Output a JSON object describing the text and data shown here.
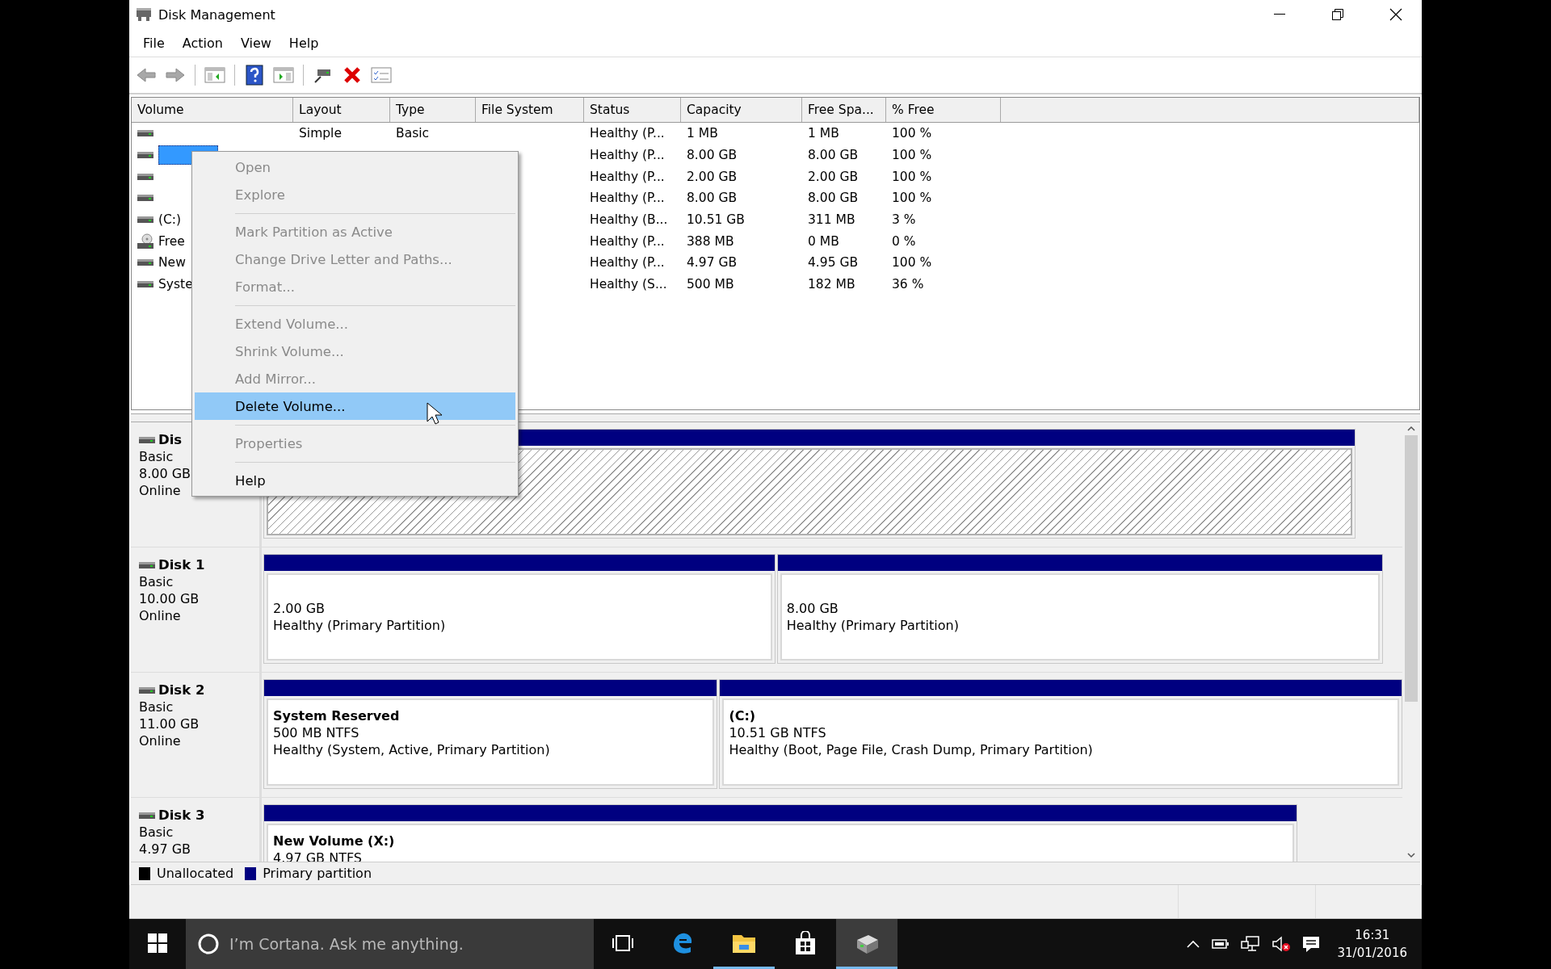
{
  "window": {
    "title": "Disk Management"
  },
  "menu_bar": [
    "File",
    "Action",
    "View",
    "Help"
  ],
  "toolbar": [
    {
      "kind": "back",
      "disabled": true
    },
    {
      "kind": "forward",
      "disabled": true
    },
    {
      "kind": "tree"
    },
    {
      "kind": "help"
    },
    {
      "kind": "panel"
    },
    {
      "kind": "connect"
    },
    {
      "kind": "delete"
    },
    {
      "kind": "properties"
    }
  ],
  "volume_table": {
    "columns": [
      "Volume",
      "Layout",
      "Type",
      "File System",
      "Status",
      "Capacity",
      "Free Spa...",
      "% Free"
    ],
    "rows": [
      {
        "kind": "disk",
        "selected": false,
        "cells": [
          null,
          "Simple",
          "Basic",
          null,
          "Healthy (P...",
          "1 MB",
          "1 MB",
          "100 %"
        ]
      },
      {
        "kind": "disk",
        "selected": true,
        "cells": [
          null,
          null,
          null,
          null,
          "Healthy (P...",
          "8.00 GB",
          "8.00 GB",
          "100 %"
        ]
      },
      {
        "kind": "disk",
        "selected": false,
        "cells": [
          null,
          null,
          null,
          null,
          "Healthy (P...",
          "2.00 GB",
          "2.00 GB",
          "100 %"
        ]
      },
      {
        "kind": "disk",
        "selected": false,
        "cells": [
          null,
          null,
          null,
          null,
          "Healthy (P...",
          "8.00 GB",
          "8.00 GB",
          "100 %"
        ]
      },
      {
        "kind": "disk",
        "selected": false,
        "cells": [
          "(C:)",
          null,
          null,
          null,
          "Healthy (B...",
          "10.51 GB",
          "311 MB",
          "3 %"
        ]
      },
      {
        "kind": "cdrom",
        "selected": false,
        "cells": [
          "Free",
          null,
          null,
          null,
          "Healthy (P...",
          "388 MB",
          "0 MB",
          "0 %"
        ]
      },
      {
        "kind": "disk",
        "selected": false,
        "cells": [
          "New",
          null,
          null,
          null,
          "Healthy (P...",
          "4.97 GB",
          "4.95 GB",
          "100 %"
        ]
      },
      {
        "kind": "disk",
        "selected": false,
        "cells": [
          "Syste",
          null,
          null,
          null,
          "Healthy (S...",
          "500 MB",
          "182 MB",
          "36 %"
        ]
      }
    ]
  },
  "context_menu": {
    "groups": [
      [
        {
          "label": "Open",
          "disabled": true,
          "selected": false
        },
        {
          "label": "Explore",
          "disabled": true,
          "selected": false
        }
      ],
      [
        {
          "label": "Mark Partition as Active",
          "disabled": true,
          "selected": false
        },
        {
          "label": "Change Drive Letter and Paths...",
          "disabled": true,
          "selected": false
        },
        {
          "label": "Format...",
          "disabled": true,
          "selected": false
        }
      ],
      [
        {
          "label": "Extend Volume...",
          "disabled": true,
          "selected": false
        },
        {
          "label": "Shrink Volume...",
          "disabled": true,
          "selected": false
        },
        {
          "label": "Add Mirror...",
          "disabled": true,
          "selected": false
        },
        {
          "label": "Delete Volume...",
          "disabled": false,
          "selected": true
        }
      ],
      [
        {
          "label": "Properties",
          "disabled": true,
          "selected": false
        }
      ],
      [
        {
          "label": "Help",
          "disabled": false,
          "selected": false
        }
      ]
    ]
  },
  "disks": [
    {
      "name": "Dis",
      "type": "Basic",
      "size": "8.00 GB",
      "status": "Online",
      "partitions": [
        {
          "selected": true
        }
      ]
    },
    {
      "name": "Disk 1",
      "type": "Basic",
      "size": "10.00 GB",
      "status": "Online",
      "partitions": [
        {
          "selected": false,
          "size": "2.00 GB",
          "health": "Healthy (Primary Partition)"
        },
        {
          "selected": false,
          "size": "8.00 GB",
          "health": "Healthy (Primary Partition)"
        }
      ]
    },
    {
      "name": "Disk 2",
      "type": "Basic",
      "size": "11.00 GB",
      "status": "Online",
      "partitions": [
        {
          "selected": false,
          "label": "System Reserved",
          "size": "500 MB NTFS",
          "health": "Healthy (System, Active, Primary Partition)"
        },
        {
          "selected": false,
          "label": "(C:)",
          "size": "10.51 GB NTFS",
          "health": "Healthy (Boot, Page File, Crash Dump, Primary Partition)"
        }
      ]
    },
    {
      "name": "Disk 3",
      "type": "Basic",
      "size": "4.97 GB",
      "partitions": [
        {
          "selected": false,
          "label": "New Volume  (X:)",
          "size": "4.97 GB NTFS"
        }
      ]
    }
  ],
  "legend": [
    {
      "label": "Unallocated",
      "color": "#000000"
    },
    {
      "label": "Primary partition",
      "color": "#000080"
    }
  ],
  "taskbar": {
    "search_placeholder": "I’m Cortana. Ask me anything.",
    "apps": [
      {
        "kind": "taskview",
        "running": false,
        "selected": false
      },
      {
        "kind": "edge",
        "running": false,
        "selected": false
      },
      {
        "kind": "explorer",
        "running": true,
        "selected": false
      },
      {
        "kind": "store",
        "running": false,
        "selected": false
      },
      {
        "kind": "diskmgmt",
        "running": true,
        "selected": true
      }
    ],
    "time": "16:31",
    "date": "31/01/2016"
  }
}
